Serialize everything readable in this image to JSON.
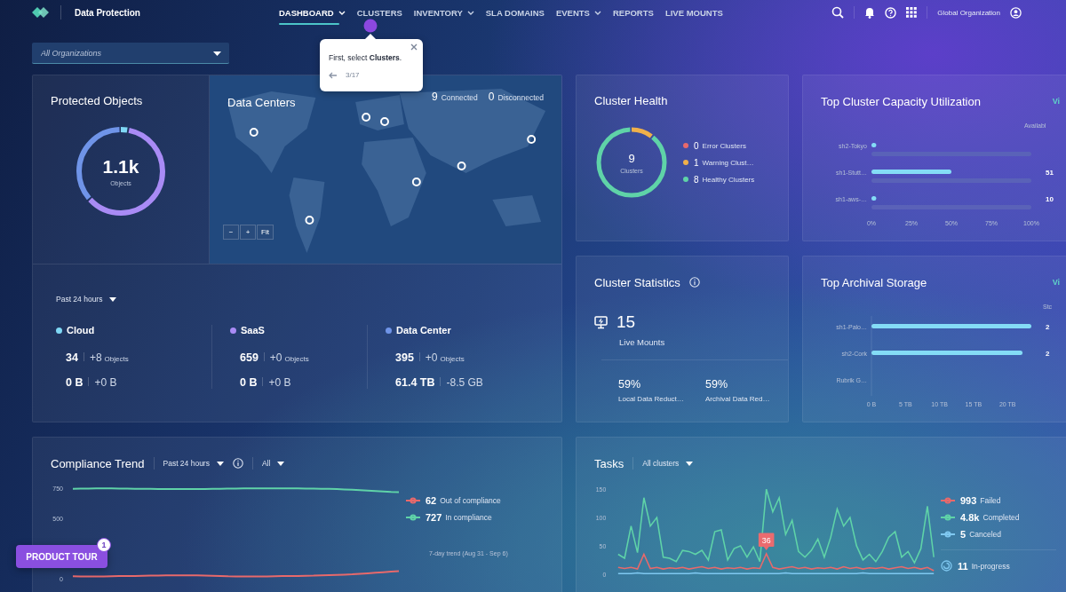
{
  "header": {
    "product": "Data Protection",
    "nav": [
      {
        "label": "DASHBOARD",
        "selected": true,
        "dropdown": true
      },
      {
        "label": "CLUSTERS",
        "selected": false,
        "dropdown": false
      },
      {
        "label": "INVENTORY",
        "selected": false,
        "dropdown": true
      },
      {
        "label": "SLA DOMAINS",
        "selected": false,
        "dropdown": false
      },
      {
        "label": "EVENTS",
        "selected": false,
        "dropdown": true
      },
      {
        "label": "REPORTS",
        "selected": false,
        "dropdown": false
      },
      {
        "label": "LIVE MOUNTS",
        "selected": false,
        "dropdown": false
      }
    ],
    "organization": "Global Organization"
  },
  "org_filter": {
    "placeholder": "All Organizations"
  },
  "tour_tip": {
    "text": "First, select **Clusters**.",
    "step": "3/17"
  },
  "protected_objects": {
    "title": "Protected Objects",
    "total": "1.1k",
    "unit": "Objects",
    "range": "Past 24 hours",
    "categories": [
      {
        "name": "Cloud",
        "color": "#7fd8f5",
        "count": "34",
        "count_delta": "+8",
        "count_unit": "Objects",
        "size": "0 B",
        "size_delta": "+0 B"
      },
      {
        "name": "SaaS",
        "color": "#a98bf5",
        "count": "659",
        "count_delta": "+0",
        "count_unit": "Objects",
        "size": "0 B",
        "size_delta": "+0 B"
      },
      {
        "name": "Data Center",
        "color": "#6f94e8",
        "count": "395",
        "count_delta": "+0",
        "count_unit": "Objects",
        "size": "61.4 TB",
        "size_delta": "-8.5 GB"
      }
    ]
  },
  "data_centers": {
    "title": "Data Centers",
    "connected": "9",
    "connected_label": "Connected",
    "disconnected": "0",
    "disconnected_label": "Disconnected",
    "map_controls": [
      "−",
      "+",
      "Fit"
    ]
  },
  "cluster_health": {
    "title": "Cluster Health",
    "total": "9",
    "unit": "Clusters",
    "items": [
      {
        "count": "0",
        "label": "Error Clusters",
        "color": "#e8696b"
      },
      {
        "count": "1",
        "label": "Warning Clust…",
        "color": "#f0b04a"
      },
      {
        "count": "8",
        "label": "Healthy Clusters",
        "color": "#5fd3a8"
      }
    ]
  },
  "capacity": {
    "title": "Top Cluster Capacity Utilization",
    "link": "Vi",
    "side_column": {
      "header": "Availabl",
      "lower_values": [
        "51",
        "10"
      ]
    },
    "chart_data": {
      "type": "bar",
      "orientation": "horizontal",
      "categories": [
        "sh2-Tokyo",
        "sh1-Stutt…",
        "sh1-aws-…"
      ],
      "values": [
        3,
        50,
        3
      ],
      "xlim": [
        0,
        100
      ],
      "xticks": [
        {
          "value": 0,
          "label": "0%"
        },
        {
          "value": 25,
          "label": "25%"
        },
        {
          "value": 50,
          "label": "50%"
        },
        {
          "value": 75,
          "label": "75%"
        },
        {
          "value": 100,
          "label": "100%"
        }
      ]
    }
  },
  "cluster_statistics": {
    "title": "Cluster Statistics",
    "live_mounts": "15",
    "live_mounts_label": "Live Mounts",
    "reductions": [
      {
        "value": "59%",
        "label": "Local Data Reduct…"
      },
      {
        "value": "59%",
        "label": "Archival Data Red…"
      }
    ]
  },
  "archival": {
    "title": "Top Archival Storage",
    "link": "Vi",
    "side_column": {
      "header": "Stc",
      "upper_values": [
        "2",
        "2"
      ]
    },
    "chart_data": {
      "type": "bar",
      "orientation": "horizontal",
      "categories": [
        "sh1-Palo…",
        "sh2-Cork",
        "Rubrik G…"
      ],
      "values": [
        23.5,
        22.2,
        0
      ],
      "xlim": [
        0,
        23.5
      ],
      "xticks": [
        {
          "value": 0,
          "label": "0 B"
        },
        {
          "value": 5,
          "label": "5 TB"
        },
        {
          "value": 10,
          "label": "10 TB"
        },
        {
          "value": 15,
          "label": "15 TB"
        },
        {
          "value": 20,
          "label": "20 TB"
        }
      ]
    }
  },
  "compliance": {
    "title": "Compliance Trend",
    "range": "Past 24 hours",
    "filter": "All",
    "footnote": "7-day trend (Aug 31 - Sep 6)",
    "legend": [
      {
        "count": "62"
      },
      {
        "count": "727"
      }
    ],
    "chart_data": {
      "type": "line",
      "ylim": [
        0,
        750
      ],
      "yticks": [
        0,
        500,
        750
      ],
      "series": [
        {
          "name": "Out of compliance",
          "color": "#e8696b",
          "values": [
            20,
            19,
            18,
            18,
            19,
            20,
            21,
            22,
            23,
            24,
            25,
            26,
            27,
            28,
            28,
            28,
            27,
            26,
            24,
            22,
            20,
            19,
            18,
            18,
            18,
            19,
            20,
            21,
            22,
            23,
            24,
            25,
            27,
            29,
            31,
            34,
            37,
            41,
            45,
            50,
            54,
            58,
            62
          ]
        },
        {
          "name": "In compliance",
          "color": "#5fd3a8",
          "values": [
            745,
            746,
            747,
            748,
            748,
            748,
            747,
            746,
            745,
            744,
            744,
            743,
            743,
            742,
            742,
            742,
            742,
            743,
            744,
            745,
            746,
            747,
            748,
            748,
            748,
            748,
            748,
            748,
            748,
            748,
            747,
            746,
            745,
            744,
            742,
            740,
            737,
            734,
            730,
            726,
            722,
            719,
            718
          ]
        }
      ]
    }
  },
  "tasks": {
    "title": "Tasks",
    "filter": "All clusters",
    "legend": [
      {
        "count": "993"
      },
      {
        "count": "4.8k"
      },
      {
        "count": "5"
      }
    ],
    "in_progress": {
      "count": "11",
      "label": "In-progress"
    },
    "peak_tag": "36",
    "chart_data": {
      "type": "line",
      "ylim": [
        0,
        150
      ],
      "yticks": [
        0,
        50,
        100,
        150
      ],
      "series": [
        {
          "name": "Failed",
          "color": "#e8696b",
          "values": [
            12,
            10,
            12,
            9,
            35,
            10,
            12,
            9,
            11,
            10,
            12,
            9,
            11,
            13,
            10,
            12,
            9,
            11,
            10,
            12,
            9,
            11,
            10,
            36,
            12,
            9,
            11,
            13,
            10,
            12,
            9,
            11,
            10,
            12,
            9,
            13,
            10,
            12,
            9,
            11,
            10,
            12,
            9,
            11,
            13,
            10,
            12,
            9,
            12,
            6
          ]
        },
        {
          "name": "Completed",
          "color": "#5fd3a8",
          "values": [
            35,
            28,
            85,
            38,
            135,
            85,
            100,
            30,
            28,
            22,
            42,
            40,
            35,
            42,
            25,
            75,
            78,
            25,
            45,
            50,
            30,
            48,
            22,
            150,
            110,
            135,
            70,
            95,
            40,
            30,
            42,
            62,
            30,
            65,
            115,
            85,
            100,
            50,
            25,
            35,
            22,
            40,
            65,
            75,
            30,
            40,
            20,
            45,
            120,
            30
          ]
        },
        {
          "name": "Canceled",
          "color": "#7fc8f0",
          "values": [
            1,
            1,
            1,
            2,
            1,
            1,
            1,
            1,
            1,
            1,
            1,
            1,
            2,
            1,
            1,
            1,
            1,
            1,
            1,
            1,
            1,
            1,
            1,
            1,
            1,
            1,
            2,
            1,
            1,
            1,
            1,
            1,
            1,
            1,
            1,
            1,
            1,
            1,
            2,
            1,
            1,
            1,
            1,
            1,
            1,
            1,
            1,
            1,
            1,
            1
          ]
        }
      ]
    }
  },
  "product_tour": {
    "label": "PRODUCT TOUR",
    "badge": "1"
  }
}
